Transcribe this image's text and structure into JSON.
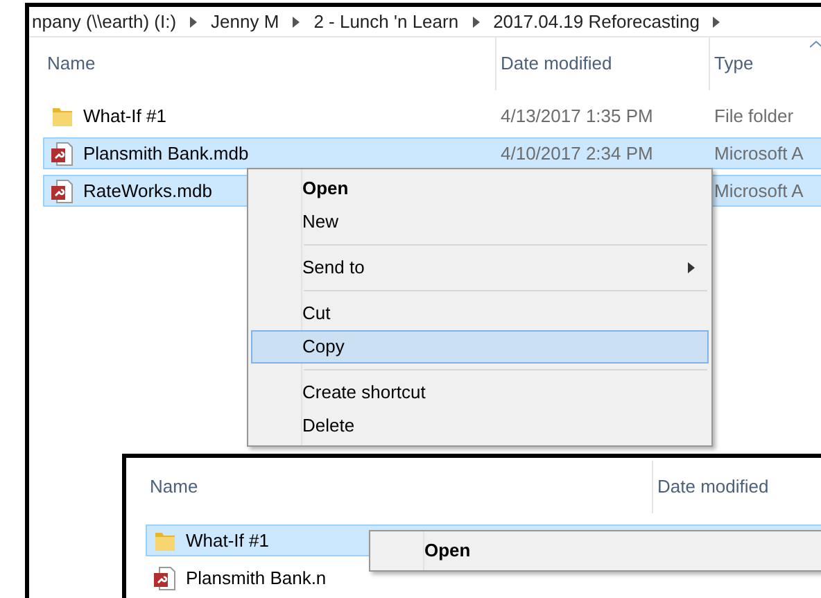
{
  "back_window": {
    "breadcrumb": [
      "npany (\\\\earth) (I:)",
      "Jenny M",
      "2 - Lunch 'n Learn",
      "2017.04.19 Reforecasting"
    ],
    "columns": [
      "Name",
      "Date modified",
      "Type"
    ],
    "rows": [
      {
        "kind": "folder",
        "name": "What-If #1",
        "date": "4/13/2017 1:35 PM",
        "type": "File folder",
        "selected": false
      },
      {
        "kind": "database",
        "name": "Plansmith Bank.mdb",
        "date": "4/10/2017 2:34 PM",
        "type": "Microsoft A",
        "selected": true
      },
      {
        "kind": "database",
        "name": "RateWorks.mdb",
        "type": "Microsoft A",
        "selected": true
      }
    ],
    "context_menu": [
      {
        "kind": "item",
        "label": "Open",
        "default": true,
        "selected": false
      },
      {
        "kind": "item",
        "label": "New",
        "default": false,
        "selected": false
      },
      {
        "kind": "separator"
      },
      {
        "kind": "submenu",
        "label": "Send to",
        "default": false,
        "selected": false
      },
      {
        "kind": "separator"
      },
      {
        "kind": "item",
        "label": "Cut",
        "default": false,
        "selected": false
      },
      {
        "kind": "item",
        "label": "Copy",
        "default": false,
        "selected": true
      },
      {
        "kind": "separator"
      },
      {
        "kind": "item",
        "label": "Create shortcut",
        "default": false,
        "selected": false
      },
      {
        "kind": "item",
        "label": "Delete",
        "default": false,
        "selected": false
      }
    ]
  },
  "front_window": {
    "columns": [
      "Name",
      "Date modified"
    ],
    "rows": [
      {
        "kind": "folder",
        "name": "What-If #1",
        "selected": true
      },
      {
        "kind": "database",
        "name": "Plansmith Bank.n",
        "selected": false
      }
    ],
    "context_menu": [
      {
        "kind": "item",
        "label": "Open",
        "default": true,
        "selected": false
      }
    ]
  }
}
